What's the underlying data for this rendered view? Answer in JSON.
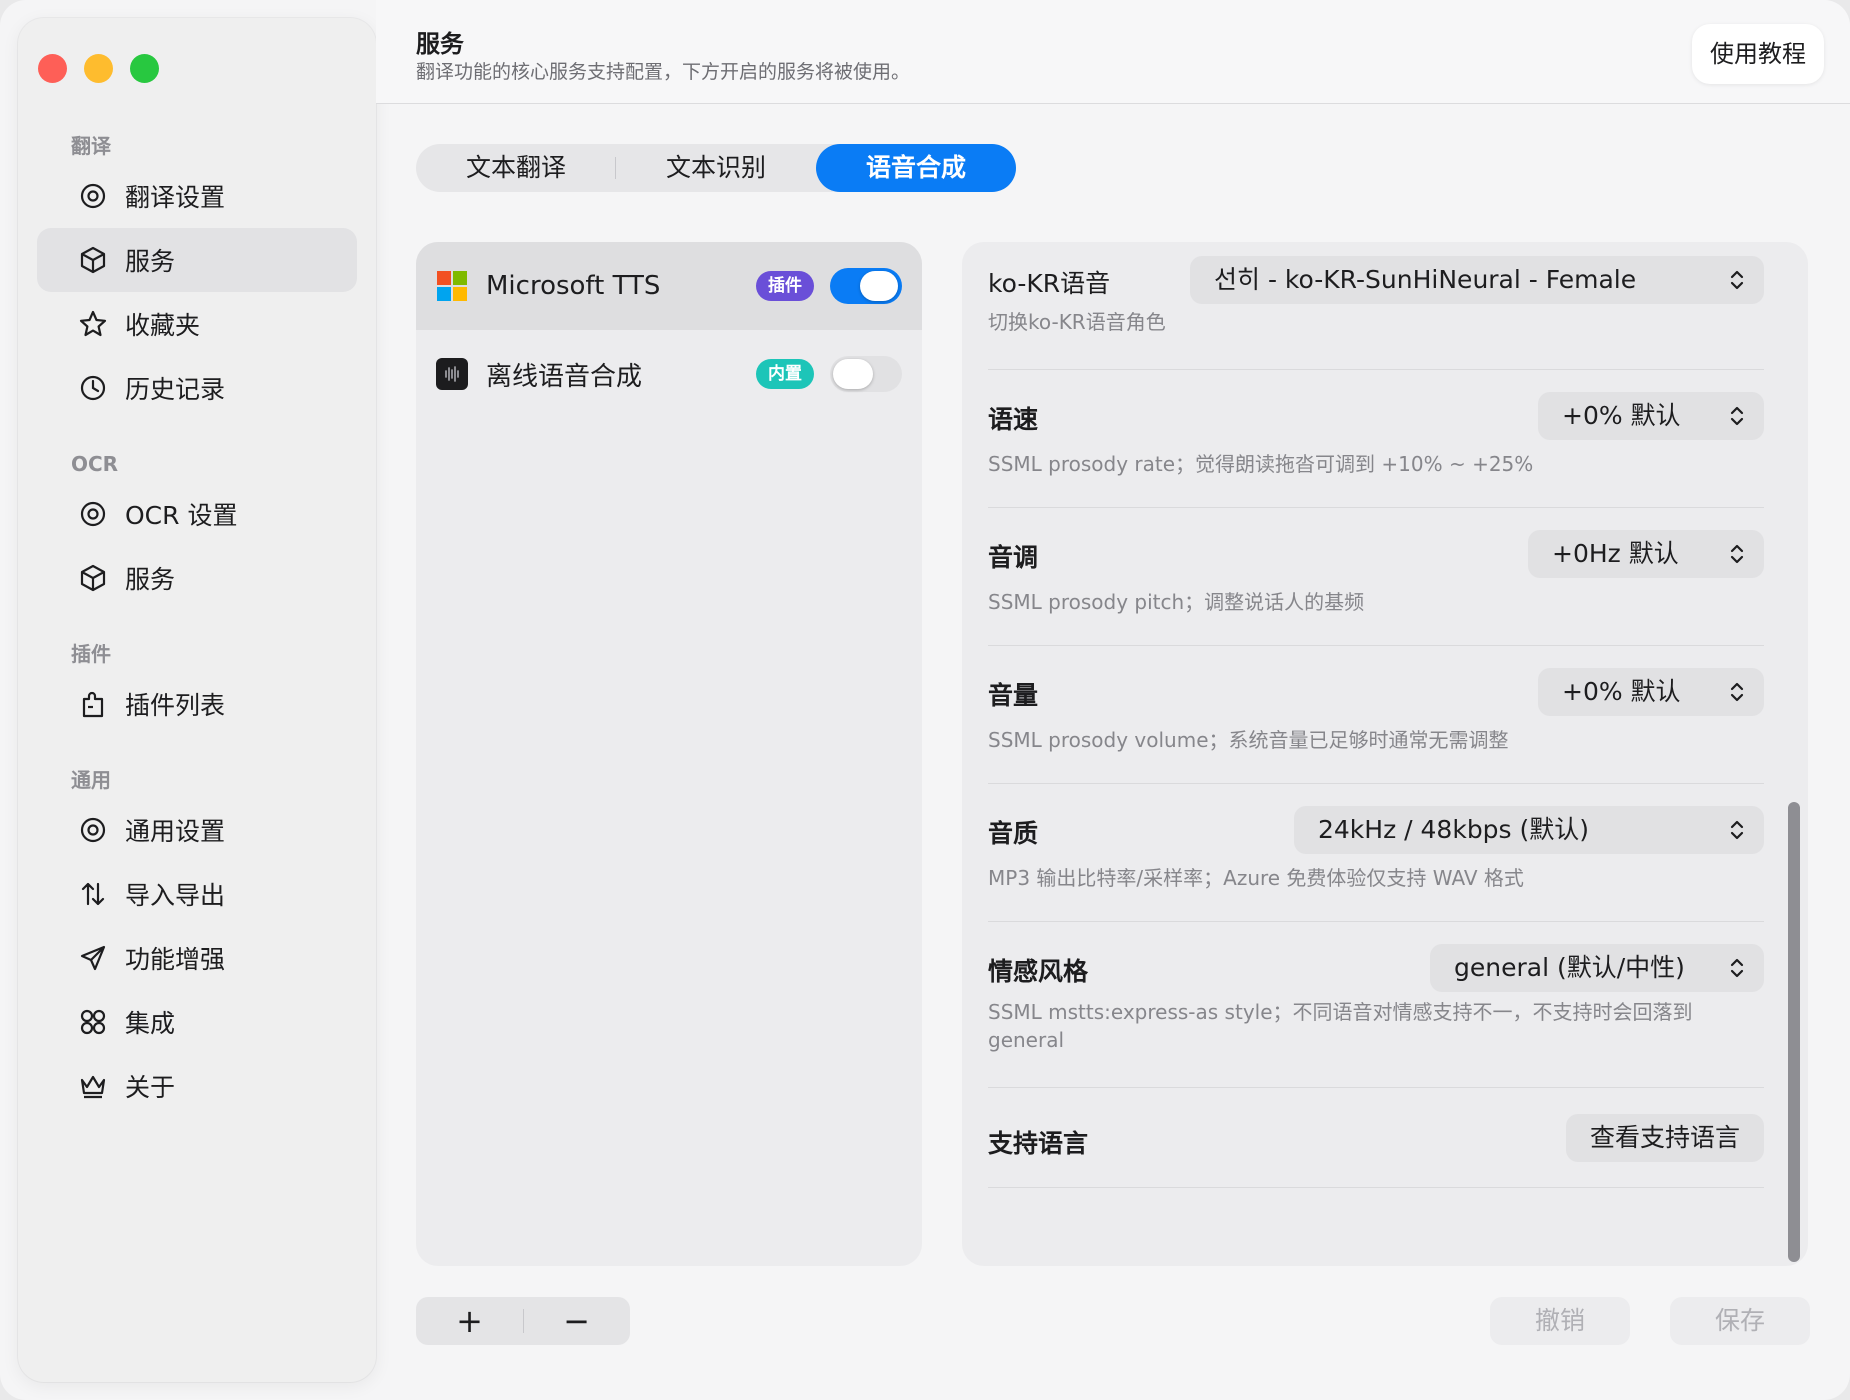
{
  "sidebar": {
    "sections": [
      {
        "title": "翻译",
        "items": [
          {
            "label": "翻译设置",
            "icon": "settings-circle-icon"
          },
          {
            "label": "服务",
            "icon": "cube-icon",
            "active": true
          },
          {
            "label": "收藏夹",
            "icon": "star-icon"
          },
          {
            "label": "历史记录",
            "icon": "clock-icon"
          }
        ]
      },
      {
        "title": "OCR",
        "items": [
          {
            "label": "OCR 设置",
            "icon": "settings-circle-icon"
          },
          {
            "label": "服务",
            "icon": "cube-icon"
          }
        ]
      },
      {
        "title": "插件",
        "items": [
          {
            "label": "插件列表",
            "icon": "puzzle-icon"
          }
        ]
      },
      {
        "title": "通用",
        "items": [
          {
            "label": "通用设置",
            "icon": "settings-circle-icon"
          },
          {
            "label": "导入导出",
            "icon": "arrows-updown-icon"
          },
          {
            "label": "功能增强",
            "icon": "paper-plane-icon"
          },
          {
            "label": "集成",
            "icon": "integration-icon"
          },
          {
            "label": "关于",
            "icon": "crown-icon"
          }
        ]
      }
    ]
  },
  "header": {
    "title": "服务",
    "subtitle": "翻译功能的核心服务支持配置，下方开启的服务将被使用。",
    "tutorial_label": "使用教程"
  },
  "tabs": [
    {
      "label": "文本翻译",
      "active": false
    },
    {
      "label": "文本识别",
      "active": false
    },
    {
      "label": "语音合成",
      "active": true
    }
  ],
  "services": [
    {
      "name": "Microsoft TTS",
      "badge": "插件",
      "enabled": true,
      "selected": true,
      "icon": "microsoft-logo-icon"
    },
    {
      "name": "离线语音合成",
      "badge": "内置",
      "enabled": false,
      "selected": false,
      "icon": "waveform-icon"
    }
  ],
  "settings": [
    {
      "label": "ko-KR语音",
      "value": "선히 - ko-KR-SunHiNeural - Female",
      "desc": "切换ko-KR语音角色",
      "control": "select"
    },
    {
      "label": "语速",
      "value": "+0% 默认",
      "desc": "SSML prosody rate；觉得朗读拖沓可调到 +10% ~ +25%",
      "control": "select"
    },
    {
      "label": "音调",
      "value": "+0Hz 默认",
      "desc": "SSML prosody pitch；调整说话人的基频",
      "control": "select"
    },
    {
      "label": "音量",
      "value": "+0% 默认",
      "desc": "SSML prosody volume；系统音量已足够时通常无需调整",
      "control": "select"
    },
    {
      "label": "音质",
      "value": "24kHz / 48kbps (默认)",
      "desc": "MP3 输出比特率/采样率；Azure 免费体验仅支持 WAV 格式",
      "control": "select"
    },
    {
      "label": "情感风格",
      "value": "general (默认/中性)",
      "desc": "SSML mstts:express-as style；不同语音对情感支持不一，不支持时会回落到 general",
      "control": "select"
    },
    {
      "label": "支持语言",
      "value": "查看支持语言",
      "desc": "",
      "control": "button"
    }
  ],
  "bottom": {
    "add_label": "+",
    "remove_label": "−",
    "cancel_label": "撤销",
    "save_label": "保存"
  },
  "colors": {
    "accent": "#0a7cf5",
    "plugin_badge": "#6a4fd8",
    "builtin_badge": "#1dc5b8"
  }
}
